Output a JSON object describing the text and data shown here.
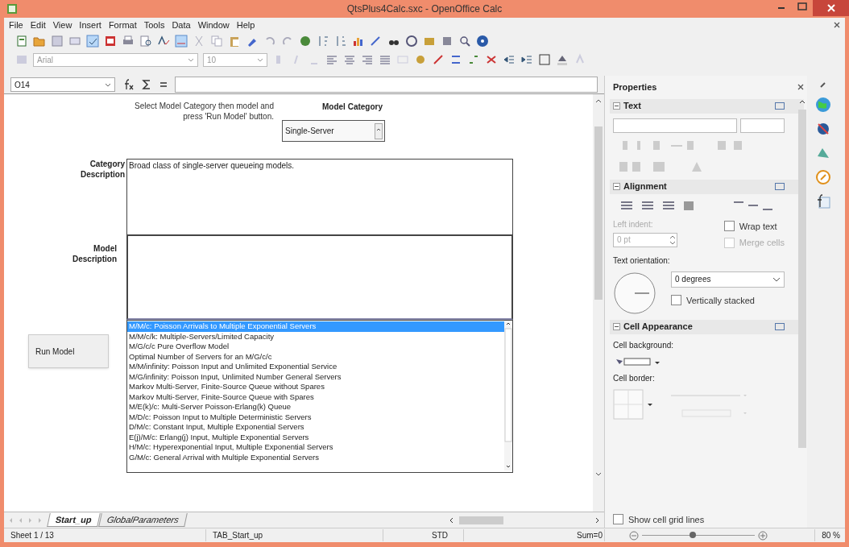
{
  "window": {
    "title": "QtsPlus4Calc.sxc - OpenOffice Calc"
  },
  "menu": [
    "File",
    "Edit",
    "View",
    "Insert",
    "Format",
    "Tools",
    "Data",
    "Window",
    "Help"
  ],
  "formatting": {
    "font": "Arial",
    "size": "10"
  },
  "formula_bar": {
    "cell_ref": "O14"
  },
  "sheet": {
    "instruction": "Select Model Category then model and press 'Run Model' button.",
    "category_label": "Model Category",
    "category_value": "Single-Server",
    "category_description_label": "Category Description",
    "category_description": "Broad class of single-server queueing models.",
    "model_description_label": "Model Description",
    "run_button": "Run Model",
    "models": [
      {
        "label": "M/M/c: Poisson Arrivals to Multiple Exponential Servers",
        "selected": true
      },
      {
        "label": "M/M/c/k:  Multiple-Servers/Limited Capacity",
        "selected": false
      },
      {
        "label": "M/G/c/c Pure Overflow Model",
        "selected": false
      },
      {
        "label": "Optimal Number of Servers for an M/G/c/c",
        "selected": false
      },
      {
        "label": "M/M/infinity: Poisson Input and Unlimited Exponential Service",
        "selected": false
      },
      {
        "label": "M/G/infinity: Poisson Input, Unlimited Number General Servers",
        "selected": false
      },
      {
        "label": "Markov Multi-Server, Finite-Source Queue without Spares",
        "selected": false
      },
      {
        "label": "Markov Multi-Server, Finite-Source Queue with Spares",
        "selected": false
      },
      {
        "label": "M/E(k)/c: Multi-Server Poisson-Erlang(k) Queue",
        "selected": false
      },
      {
        "label": "M/D/c:  Poisson Input to Multiple Deterministic Servers",
        "selected": false
      },
      {
        "label": "D/M/c: Constant Input, Multiple Exponential Servers",
        "selected": false
      },
      {
        "label": "E(j)/M/c: Erlang(j) Input, Multiple Exponential Servers",
        "selected": false
      },
      {
        "label": "H/M/c: Hyperexponential Input, Multiple Exponential Servers",
        "selected": false
      },
      {
        "label": "G/M/c: General Arrival with Multiple Exponential Servers",
        "selected": false
      }
    ]
  },
  "sheet_tabs": [
    {
      "label": "Start_up",
      "selected": true
    },
    {
      "label": "GlobalParameters",
      "selected": false
    }
  ],
  "sidebar": {
    "title": "Properties",
    "text_section": "Text",
    "alignment_section": "Alignment",
    "left_indent_label": "Left indent:",
    "left_indent": "0 pt",
    "wrap_text": {
      "label": "Wrap text",
      "checked": false
    },
    "merge_cells": {
      "label": "Merge cells",
      "checked": false,
      "disabled": true
    },
    "orientation_label": "Text orientation:",
    "orientation": "0 degrees",
    "vertically_stacked": {
      "label": "Vertically stacked",
      "checked": false
    },
    "appearance_section": "Cell Appearance",
    "background_label": "Cell background:",
    "border_label": "Cell border:",
    "show_grid": {
      "label": "Show cell grid lines",
      "checked": false
    }
  },
  "status_bar": {
    "sheet": "Sheet 1 / 13",
    "page_style": "TAB_Start_up",
    "mode": "STD",
    "sum": "Sum=0",
    "zoom": {
      "level": 0.45,
      "reading": "80 %"
    }
  }
}
